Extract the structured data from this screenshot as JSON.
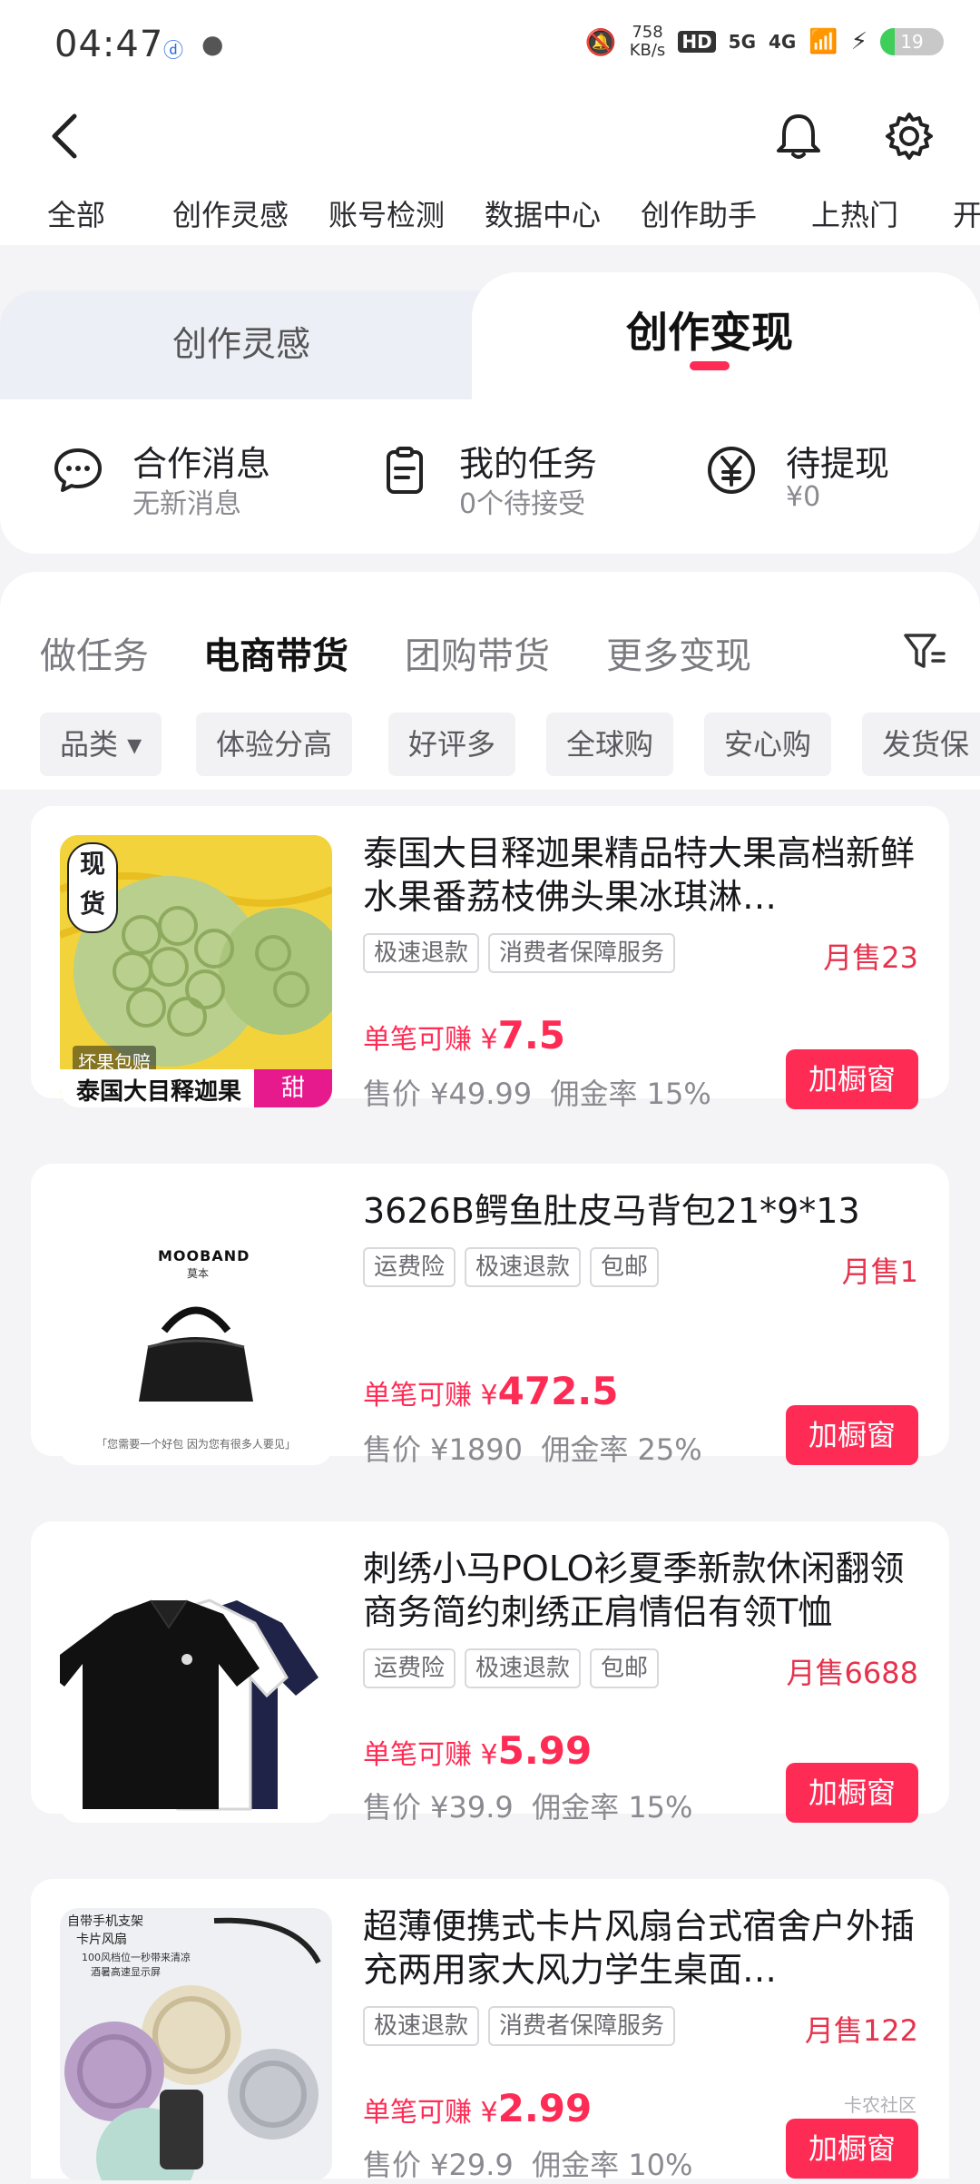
{
  "status_bar": {
    "time": "04:47",
    "speed_value": "758",
    "speed_unit": "KB/s",
    "hd_label": "HD",
    "net_5g": "5G",
    "net_4g": "4G",
    "battery": "19"
  },
  "top_nav": {
    "items": [
      "全部",
      "创作灵感",
      "账号检测",
      "数据中心",
      "创作助手",
      "上热门",
      "开"
    ]
  },
  "segment": {
    "left_label": "创作灵感",
    "right_label": "创作变现"
  },
  "summary": {
    "items": [
      {
        "title": "合作消息",
        "subtitle": "无新消息"
      },
      {
        "title": "我的任务",
        "subtitle": "0个待接受"
      },
      {
        "title": "待提现",
        "subtitle": "¥0"
      }
    ]
  },
  "tabs": {
    "items": [
      "做任务",
      "电商带货",
      "团购带货",
      "更多变现"
    ],
    "active_index": 1
  },
  "filters": {
    "items": [
      "品类 ▾",
      "体验分高",
      "好评多",
      "全球购",
      "安心购",
      "发货保"
    ]
  },
  "products": [
    {
      "title": "泰国大目释迦果精品特大果高档新鲜水果番荔枝佛头果冰琪淋…",
      "tags": [
        "极速退款",
        "消费者保障服务"
      ],
      "sales": "月售23",
      "earn_label": "单笔可赚 ¥",
      "earn_value": "7.5",
      "price_label": "售价 ¥49.99",
      "commission_label": "佣金率 15%",
      "button": "加橱窗",
      "thumb": {
        "badge_top": "现",
        "badge_bottom": "货",
        "sub_tag": "坏果包赔",
        "caption": "泰国大目释迦果",
        "caption_tag": "甜"
      }
    },
    {
      "title": "3626B鳄鱼肚皮马背包21*9*13",
      "tags": [
        "运费险",
        "极速退款",
        "包邮"
      ],
      "sales": "月售1",
      "earn_label": "单笔可赚 ¥",
      "earn_value": "472.5",
      "price_label": "售价 ¥1890",
      "commission_label": "佣金率 25%",
      "button": "加橱窗",
      "thumb": {
        "brand": "MOOBAND",
        "brand_sub": "莫本",
        "slogan": "「您需要一个好包 因为您有很多人要见」"
      }
    },
    {
      "title": "刺绣小马POLO衫夏季新款休闲翻领商务简约刺绣正肩情侣有领T恤",
      "tags": [
        "运费险",
        "极速退款",
        "包邮"
      ],
      "sales": "月售6688",
      "earn_label": "单笔可赚 ¥",
      "earn_value": "5.99",
      "price_label": "售价 ¥39.9",
      "commission_label": "佣金率 15%",
      "button": "加橱窗",
      "thumb": {}
    },
    {
      "title": "超薄便携式卡片风扇台式宿舍户外插充两用家大风力学生桌面…",
      "tags": [
        "极速退款",
        "消费者保障服务"
      ],
      "sales": "月售122",
      "earn_label": "单笔可赚 ¥",
      "earn_value": "2.99",
      "price_label": "售价 ¥29.9",
      "commission_label": "佣金率 10%",
      "button": "加橱窗",
      "thumb": {
        "line1": "自带手机支架",
        "line2": "卡片风扇",
        "line3": "100风档位一秒带来清凉",
        "line4": "酒暑高速显示屏"
      }
    }
  ],
  "watermark": "卡农社区"
}
